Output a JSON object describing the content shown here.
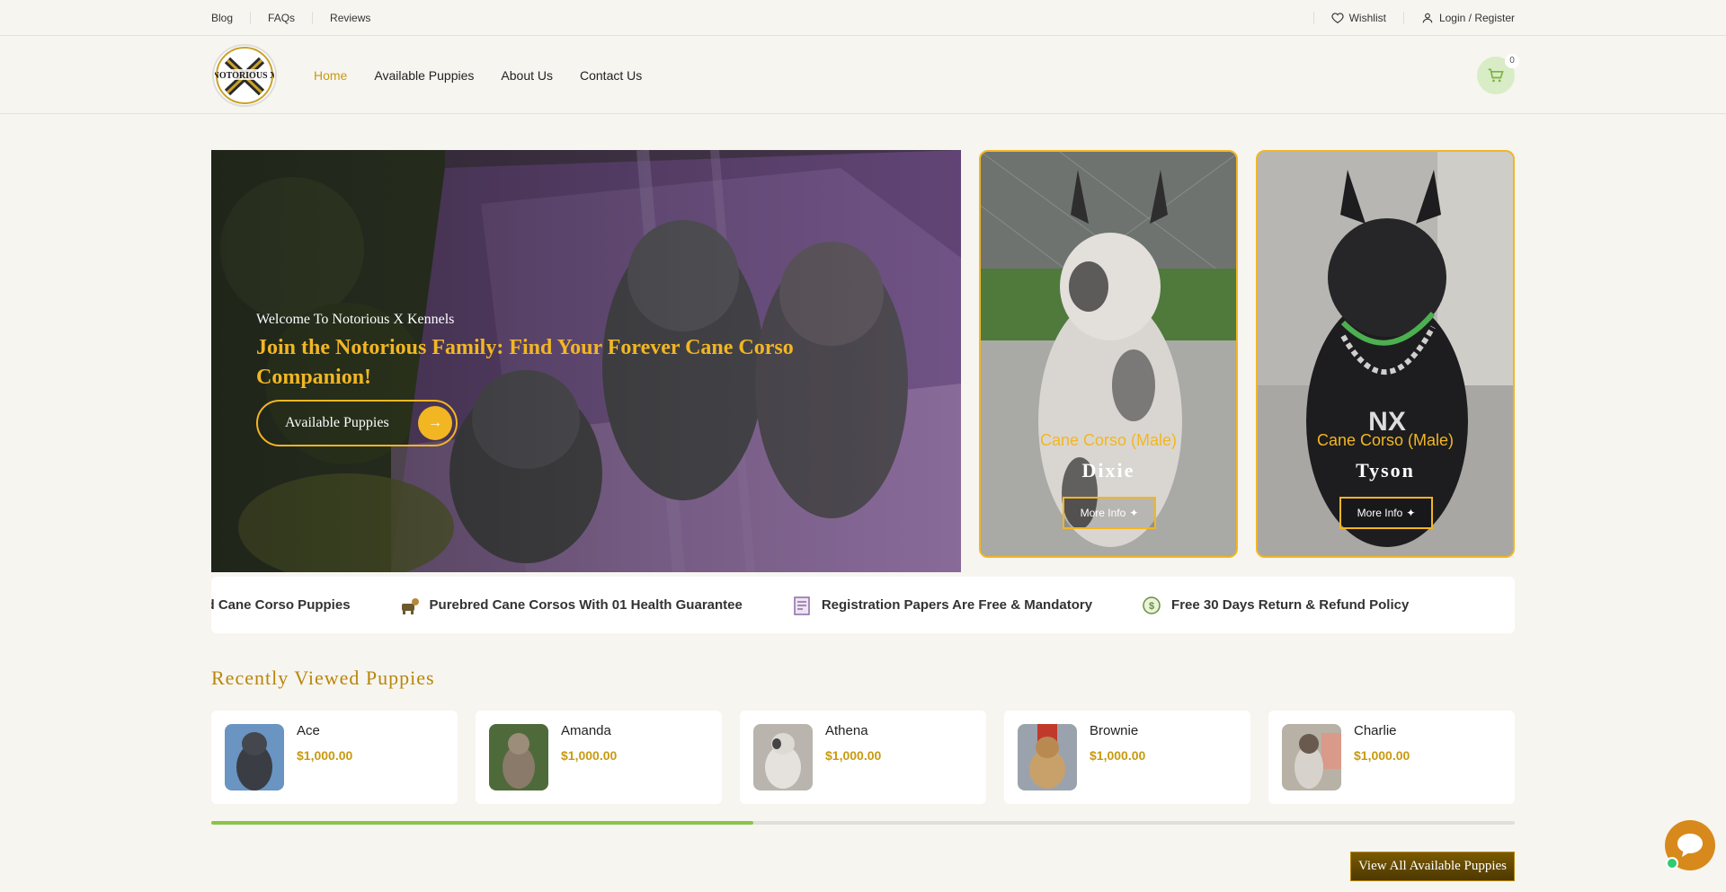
{
  "topbar": {
    "links": [
      "Blog",
      "FAQs",
      "Reviews"
    ],
    "wishlist": "Wishlist",
    "login": "Login / Register"
  },
  "header": {
    "logo_text": "NOTORIOUS X",
    "nav": [
      "Home",
      "Available Puppies",
      "About Us",
      "Contact Us"
    ],
    "active_nav": "Home",
    "cart_count": "0"
  },
  "hero": {
    "welcome": "Welcome To Notorious X Kennels",
    "headline": "Join the Notorious Family: Find Your Forever Cane Corso Companion!",
    "cta": "Available Puppies"
  },
  "featured": [
    {
      "breed": "Cane Corso (Male)",
      "name": "Dixie",
      "button": "More Info"
    },
    {
      "breed": "Cane Corso (Male)",
      "name": "Tyson",
      "button": "More Info"
    }
  ],
  "features": [
    "ned Cane Corso Puppies",
    "Purebred Cane Corsos With 01 Health Guarantee",
    "Registration Papers Are Free & Mandatory",
    "Free 30 Days Return & Refund Policy"
  ],
  "recently_viewed": {
    "title": "Recently Viewed Puppies",
    "items": [
      {
        "name": "Ace",
        "price": "$1,000.00"
      },
      {
        "name": "Amanda",
        "price": "$1,000.00"
      },
      {
        "name": "Athena",
        "price": "$1,000.00"
      },
      {
        "name": "Brownie",
        "price": "$1,000.00"
      },
      {
        "name": "Charlie",
        "price": "$1,000.00"
      }
    ],
    "scroll_progress": 0.416
  },
  "view_all": "View All Available Puppies",
  "colors": {
    "accent": "#f2b623",
    "nav_active": "#c89a10",
    "progress": "#8bc34a",
    "chat": "#d78a1b"
  }
}
